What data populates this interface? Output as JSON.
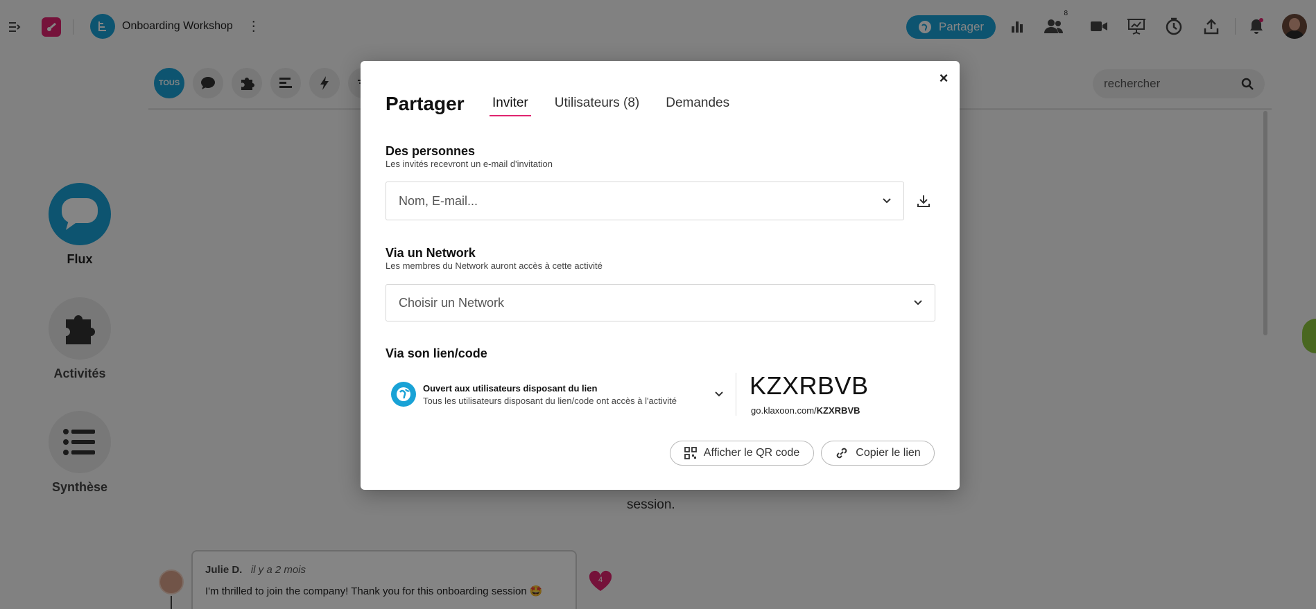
{
  "topbar": {
    "workshop_title": "Onboarding Workshop",
    "share_label": "Partager",
    "participants_count": "8"
  },
  "filters": {
    "all_label": "TOUS"
  },
  "search": {
    "placeholder": "rechercher"
  },
  "sidebar": {
    "items": [
      {
        "label": "Flux"
      },
      {
        "label": "Activités"
      },
      {
        "label": "Synthèse"
      }
    ]
  },
  "background": {
    "session_text": "session.",
    "comment": {
      "author": "Julie D.",
      "time": "il y a 2 mois",
      "message": "I'm thrilled to join the company! Thank you for this onboarding session 🤩",
      "likes": "4"
    }
  },
  "modal": {
    "title": "Partager",
    "tabs": [
      {
        "label": "Inviter",
        "active": true
      },
      {
        "label": "Utilisateurs (8)",
        "active": false
      },
      {
        "label": "Demandes",
        "active": false
      }
    ],
    "close_label": "×",
    "people": {
      "title": "Des personnes",
      "subtitle": "Les invités recevront un e-mail d'invitation",
      "placeholder": "Nom, E-mail..."
    },
    "network": {
      "title": "Via un Network",
      "subtitle": "Les membres du Network auront accès à cette activité",
      "placeholder": "Choisir un Network"
    },
    "link": {
      "title": "Via son lien/code",
      "access_title": "Ouvert aux utilisateurs disposant du lien",
      "access_subtitle": "Tous les utilisateurs disposant du lien/code ont accès à l'activité",
      "code": "KZXRBVB",
      "url_prefix": "go.klaxoon.com/",
      "url_code": "KZXRBVB",
      "qr_label": "Afficher le QR code",
      "copy_label": "Copier le lien"
    }
  },
  "colors": {
    "accent": "#19a2d6",
    "tab_underline": "#e0246f",
    "brand": "#e0246f"
  }
}
